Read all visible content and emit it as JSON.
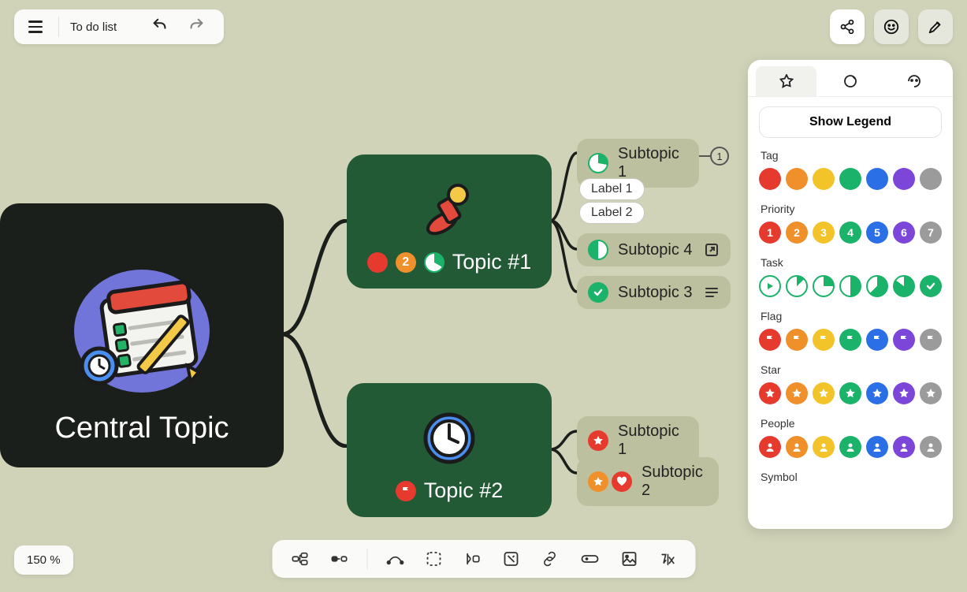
{
  "toolbar": {
    "doc_title": "To do list"
  },
  "zoom": {
    "label": "150 %"
  },
  "panel": {
    "show_legend": "Show Legend",
    "sections": {
      "tag": "Tag",
      "priority": "Priority",
      "task": "Task",
      "flag": "Flag",
      "star": "Star",
      "people": "People",
      "symbol": "Symbol"
    },
    "tag_colors": [
      "#e63a2e",
      "#f0902a",
      "#f3c32a",
      "#1bb269",
      "#2b6fe6",
      "#7c46d9",
      "#9b9b9b"
    ],
    "priority_numbers": [
      "1",
      "2",
      "3",
      "4",
      "5",
      "6",
      "7"
    ],
    "priority_colors": [
      "#e63a2e",
      "#f0902a",
      "#f3c32a",
      "#1bb269",
      "#2b6fe6",
      "#7c46d9",
      "#9b9b9b"
    ],
    "flag_colors": [
      "#e63a2e",
      "#f0902a",
      "#f3c32a",
      "#1bb269",
      "#2b6fe6",
      "#7c46d9",
      "#9b9b9b"
    ],
    "star_colors": [
      "#e63a2e",
      "#f0902a",
      "#f3c32a",
      "#1bb269",
      "#2b6fe6",
      "#7c46d9",
      "#9b9b9b"
    ],
    "people_colors": [
      "#e63a2e",
      "#f0902a",
      "#f3c32a",
      "#1bb269",
      "#2b6fe6",
      "#7c46d9",
      "#9b9b9b"
    ]
  },
  "canvas": {
    "central_title": "Central Topic",
    "topic1": {
      "title": "Topic #1"
    },
    "topic2": {
      "title": "Topic #2"
    },
    "sub1": {
      "title": "Subtopic 1",
      "badge": "1"
    },
    "sub4": {
      "title": "Subtopic 4"
    },
    "sub3": {
      "title": "Subtopic 3"
    },
    "sub5": {
      "title": "Subtopic 1"
    },
    "sub6": {
      "title": "Subtopic 2"
    },
    "label1": "Label 1",
    "label2": "Label 2"
  }
}
